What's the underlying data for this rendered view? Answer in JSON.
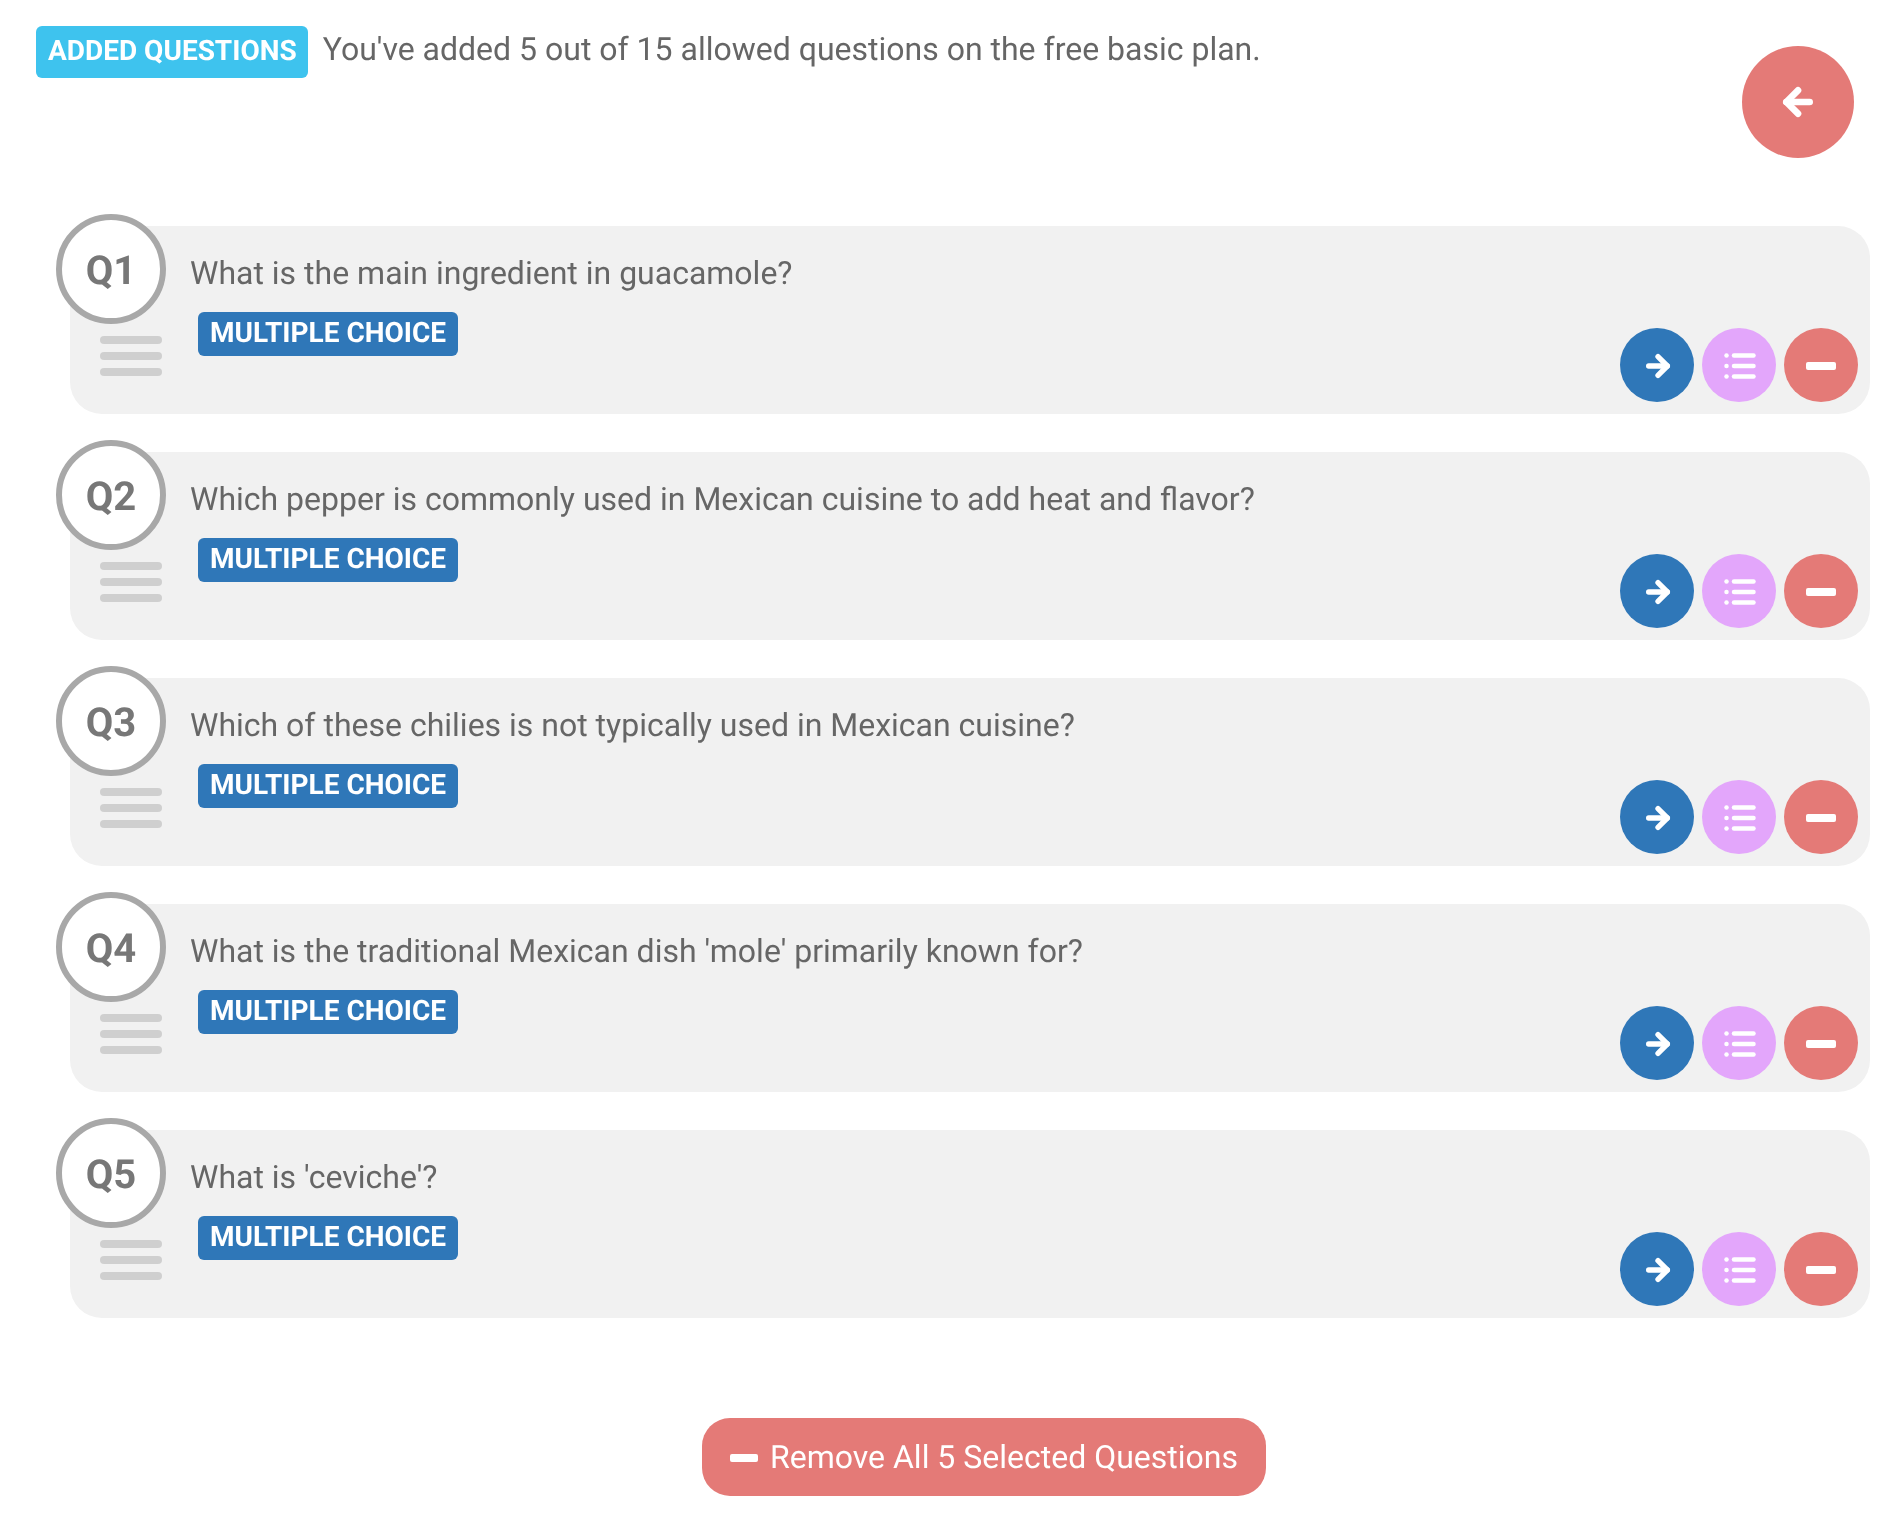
{
  "header": {
    "badge": "ADDED QUESTIONS",
    "message": "You've added 5 out of 15 allowed questions on the free basic plan."
  },
  "questions": [
    {
      "number": "Q1",
      "text": "What is the main ingredient in guacamole?",
      "type": "MULTIPLE CHOICE"
    },
    {
      "number": "Q2",
      "text": "Which pepper is commonly used in Mexican cuisine to add heat and flavor?",
      "type": "MULTIPLE CHOICE"
    },
    {
      "number": "Q3",
      "text": "Which of these chilies is not typically used in Mexican cuisine?",
      "type": "MULTIPLE CHOICE"
    },
    {
      "number": "Q4",
      "text": "What is the traditional Mexican dish 'mole' primarily known for?",
      "type": "MULTIPLE CHOICE"
    },
    {
      "number": "Q5",
      "text": "What is 'ceviche'?",
      "type": "MULTIPLE CHOICE"
    }
  ],
  "remove_all_button": "Remove All 5 Selected Questions"
}
